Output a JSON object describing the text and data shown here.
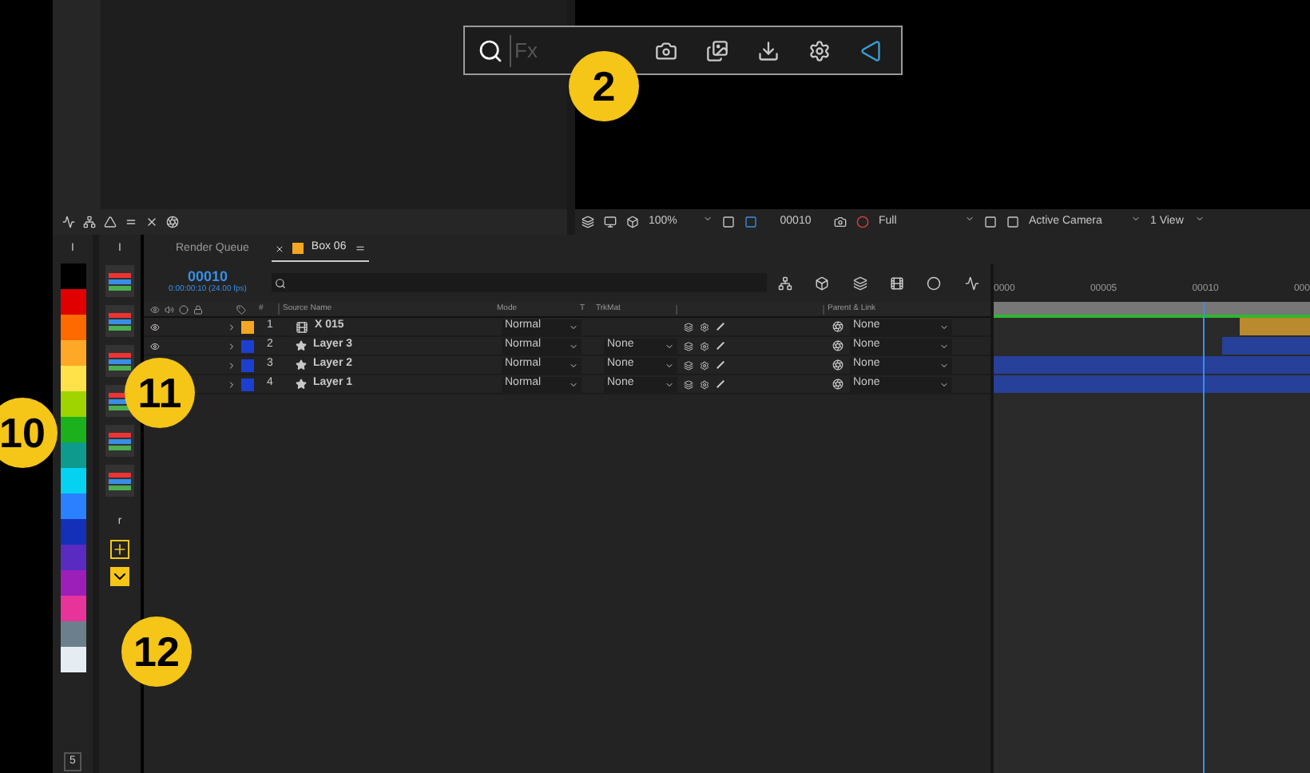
{
  "search_bar": {
    "placeholder": "Fx"
  },
  "viewer_toolbar": {
    "zoom": "100%",
    "timecode": "00010",
    "resolution": "Full",
    "camera": "Active Camera",
    "views": "1 View"
  },
  "color_swatches": {
    "header": "I",
    "footer": "5",
    "items": [
      {
        "color": "#000000"
      },
      {
        "color": "#e00000"
      },
      {
        "color": "#ff6a00"
      },
      {
        "color": "#ffa726"
      },
      {
        "color": "#ffe14a"
      },
      {
        "color": "#9fd400"
      },
      {
        "color": "#1cb01c"
      },
      {
        "color": "#0e9a8c"
      },
      {
        "color": "#05d2f0"
      },
      {
        "color": "#2a80ff"
      },
      {
        "color": "#1530b8"
      },
      {
        "color": "#5a2bc0"
      },
      {
        "color": "#9b1fb8"
      },
      {
        "color": "#e8339a"
      },
      {
        "color": "#6b808c"
      },
      {
        "color": "#e6edf2"
      }
    ]
  },
  "tools_column": {
    "header": "I",
    "section_label": "r"
  },
  "tabs": [
    {
      "label": "Render Queue",
      "selected": false
    },
    {
      "label": "Box 06",
      "selected": true,
      "color": "#f5a623"
    }
  ],
  "timeline": {
    "timecode": "00010",
    "fps": "0:00:00:10 (24.00 fps)",
    "columns": {
      "number": "#",
      "source": "Source Name",
      "mode": "Mode",
      "t": "T",
      "trkmat": "TrkMat",
      "parent": "Parent & Link"
    },
    "layers": [
      {
        "number": "1",
        "name": "X 015",
        "kind": "comp",
        "color": "#f5a623",
        "mode": "Normal",
        "parent": "None"
      },
      {
        "number": "2",
        "name": "Layer 3",
        "kind": "shape",
        "color": "#1d3fd0",
        "mode": "Normal",
        "trkmat": "None",
        "parent": "None"
      },
      {
        "number": "3",
        "name": "Layer 2",
        "kind": "shape",
        "color": "#1d3fd0",
        "mode": "Normal",
        "trkmat": "None",
        "parent": "None"
      },
      {
        "number": "4",
        "name": "Layer 1",
        "kind": "shape",
        "color": "#1d3fd0",
        "mode": "Normal",
        "trkmat": "None",
        "parent": "None"
      }
    ],
    "ruler": [
      "0000",
      "00005",
      "00010",
      "000"
    ]
  },
  "markers": [
    {
      "label": "2"
    },
    {
      "label": "10"
    },
    {
      "label": "11"
    },
    {
      "label": "12"
    }
  ]
}
